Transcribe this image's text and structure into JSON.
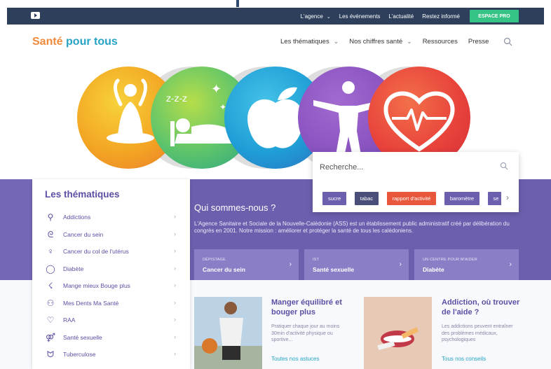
{
  "topbar": {
    "links": [
      {
        "label": "L'agence",
        "dropdown": true
      },
      {
        "label": "Les événements",
        "dropdown": false
      },
      {
        "label": "L'actualité",
        "dropdown": false
      },
      {
        "label": "Restez informé",
        "dropdown": false
      }
    ],
    "espace_pro": "ESPACE PRO",
    "youtube_icon": "youtube-icon"
  },
  "header": {
    "logo_part1": "Santé",
    "logo_part2": "pour tous",
    "nav": [
      {
        "label": "Les thématiques",
        "dropdown": true
      },
      {
        "label": "Nos chiffres santé",
        "dropdown": true
      },
      {
        "label": "Ressources",
        "dropdown": false
      },
      {
        "label": "Presse",
        "dropdown": false
      }
    ]
  },
  "hero": {
    "circles": [
      "yoga-icon",
      "sleep-icon",
      "apple-icon",
      "fitness-icon",
      "heartbeat-icon"
    ],
    "colors": [
      "#f3a623",
      "#5ec46b",
      "#1f9fd6",
      "#8b54c1",
      "#e8433b"
    ]
  },
  "search": {
    "placeholder": "Recherche...",
    "chips": [
      {
        "label": "sucre",
        "color": "#6c5fae"
      },
      {
        "label": "tabac",
        "color": "#4a4f7a"
      },
      {
        "label": "rapport d'activité",
        "color": "#e8573b"
      },
      {
        "label": "baromètre",
        "color": "#6c5fae"
      },
      {
        "label": "se",
        "color": "#6c5fae"
      }
    ]
  },
  "about": {
    "title": "Qui sommes-nous ?",
    "text": "L'Agence Sanitaire et Sociale de la Nouvelle-Calédonie (ASS) est un établissement public administratif créé par délibération du congrès en 2001. Notre mission : améliorer et protéger la santé de tous les calédoniens."
  },
  "cards": [
    {
      "sub": "DÉPISTAGE",
      "title": "Cancer du sein"
    },
    {
      "sub": "IST",
      "title": "Santé sexuelle"
    },
    {
      "sub": "UN CENTRE POUR M'AIDER",
      "title": "Diabète"
    }
  ],
  "thematiques": {
    "title": "Les thématiques",
    "items": [
      {
        "label": "Addictions",
        "icon": "pill-icon"
      },
      {
        "label": "Cancer du sein",
        "icon": "ribbon-icon"
      },
      {
        "label": "Cancer du col de l'utérus",
        "icon": "female-icon"
      },
      {
        "label": "Diabète",
        "icon": "drop-icon"
      },
      {
        "label": "Mange mieux Bouge plus",
        "icon": "runner-icon"
      },
      {
        "label": "Mes Dents Ma Santé",
        "icon": "tooth-icon"
      },
      {
        "label": "RAA",
        "icon": "heart-icon"
      },
      {
        "label": "Santé sexuelle",
        "icon": "couple-icon"
      },
      {
        "label": "Tuberculose",
        "icon": "lungs-icon"
      }
    ]
  },
  "articles": [
    {
      "title": "Manger équilibré et bouger plus",
      "text": "Pratiquer chaque jour au moins 30min d'activité physique ou sportive...",
      "link": "Toutes nos astuces"
    },
    {
      "title": "Addiction, où trouver de l'aide ?",
      "text": "Les addictions peuvent entraîner des problèmes médicaux, psychologiques",
      "link": "Tous nos conseils"
    }
  ]
}
